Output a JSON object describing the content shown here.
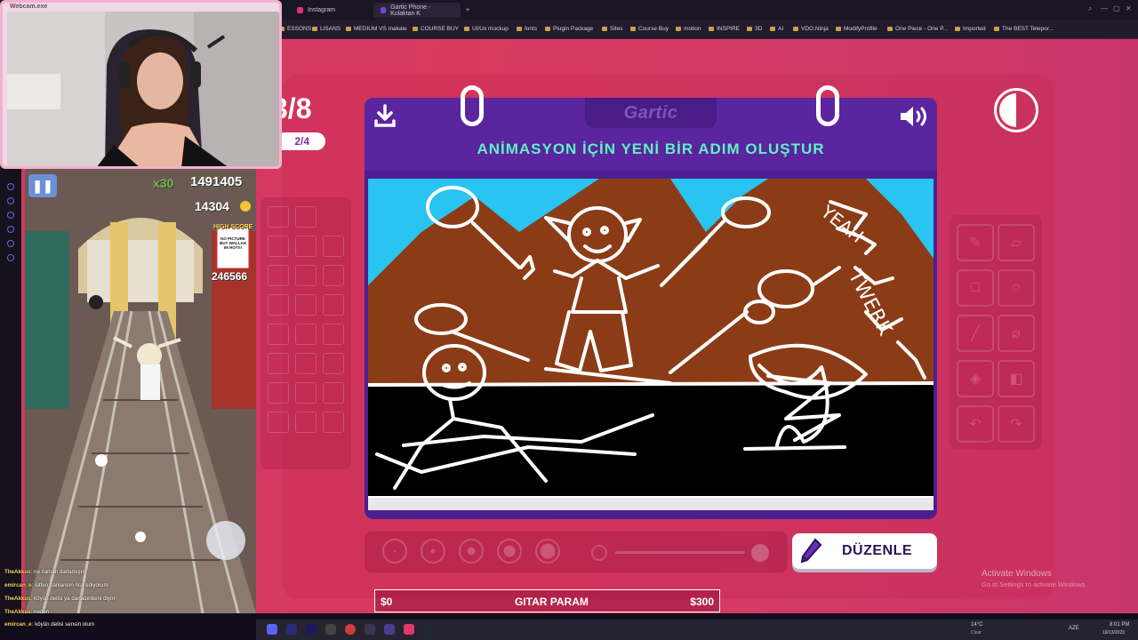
{
  "browser": {
    "tabs": [
      {
        "label": "Instagram",
        "color": "#e1306c"
      },
      {
        "label": "Gartic Phone - Kulaktan K",
        "color": "#7b3fe4"
      }
    ],
    "new_tab": "+",
    "bookmarks": [
      "ESSONS",
      "LISANS",
      "MEDIUM VS makale",
      "COURSE BUY",
      "UI/Ux mockup",
      "fonts",
      "Plugin Package",
      "Sites",
      "Course Buy",
      "motion",
      "INSPIRE",
      "3D",
      "AI",
      "VDO.Ninja",
      "ModifyProfile",
      "One Piece - One P...",
      "Imported",
      "The BEST Telepor..."
    ]
  },
  "webcam": {
    "title": "Webcam.exe"
  },
  "subway": {
    "multiplier": "x30",
    "score": "1491405",
    "coins": "14304",
    "high_score_label": "HIGH SCORE",
    "sign_text": "NO PICTURE BUT WALLAH IM HOT!!!",
    "high_score": "246566"
  },
  "chat": [
    {
      "user": "TheAkkus",
      "text": "ne zaman darlamışım"
    },
    {
      "user": "emircan_e",
      "text": "lütfen banlansın rica ediyorum"
    },
    {
      "user": "TheAkkus",
      "text": "köyün delisi ya darladınbeni diyor"
    },
    {
      "user": "TheAkkus",
      "text": "neden"
    },
    {
      "user": "emircan_e",
      "text": "köyün delisi sensin olum"
    }
  ],
  "game": {
    "round": "3/8",
    "sub_round": "2/4",
    "logo": "Gartic",
    "title": "ANİMASYON İÇİN YENİ BİR ADIM OLUŞTUR",
    "canvas_text_1": "YEAH",
    "canvas_text_2": "TWERK",
    "edit_button": "DÜZENLE",
    "goal_left": "$0",
    "goal_label": "GITAR PARAM",
    "goal_right": "$300",
    "goal_progress": 0.0,
    "colors": {
      "accent": "#5ff2c4",
      "card": "#5a259e",
      "background": "#d23763"
    }
  },
  "windows": {
    "activate_title": "Activate Windows",
    "activate_sub": "Go to Settings to activate Windows.",
    "weather": "14°C",
    "weather_sub": "Clear",
    "lang": "AZE",
    "time": "8:01 PM",
    "date": "10/13/2023"
  }
}
